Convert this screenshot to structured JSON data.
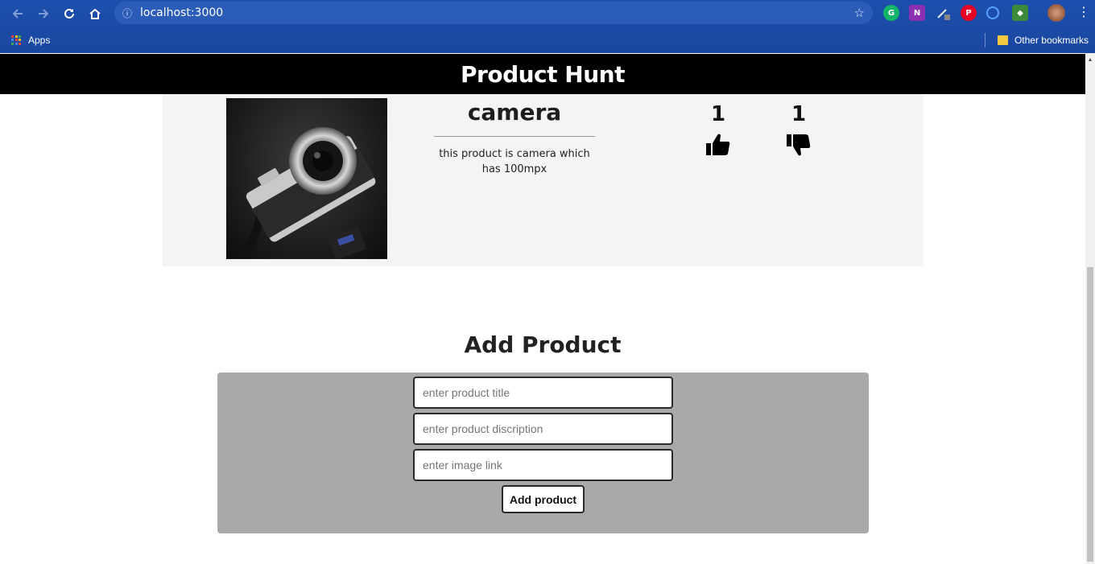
{
  "browser": {
    "url": "localhost:3000",
    "bookmarks": {
      "apps_label": "Apps",
      "other_label": "Other bookmarks"
    }
  },
  "header": {
    "title": "Product Hunt"
  },
  "product": {
    "title": "camera",
    "description": "this product is camera which has 100mpx",
    "upvotes": "1",
    "downvotes": "1"
  },
  "add_form": {
    "heading": "Add Product",
    "title_placeholder": "enter product title",
    "description_placeholder": "enter product discription",
    "image_placeholder": "enter image link",
    "submit_label": "Add product"
  },
  "colors": {
    "chrome": "#1d4fae",
    "header_bg": "#000000",
    "card_bg": "#f4f4f4",
    "form_bg": "#a9a9a9"
  }
}
